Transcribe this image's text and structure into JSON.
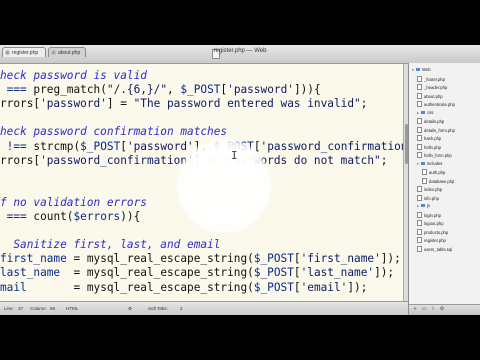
{
  "window": {
    "title": "register.php — Web",
    "tabs": [
      {
        "label": "register.php"
      },
      {
        "label": "about.php"
      }
    ]
  },
  "editor": {
    "lines": [
      [
        {
          "c": "cm",
          "t": "heck password is valid"
        }
      ],
      [
        {
          "c": "kw",
          "t": " === "
        },
        {
          "c": "fn",
          "t": "preg_match("
        },
        {
          "c": "st",
          "t": "\"/.{6,}/\""
        },
        {
          "c": "pu",
          "t": ", "
        },
        {
          "c": "kw",
          "t": "$_POST"
        },
        {
          "c": "pu",
          "t": "["
        },
        {
          "c": "st",
          "t": "'password'"
        },
        {
          "c": "pu",
          "t": "])){"
        }
      ],
      [
        {
          "c": "pu",
          "t": "rrors["
        },
        {
          "c": "st",
          "t": "'password'"
        },
        {
          "c": "pu",
          "t": "] = "
        },
        {
          "c": "st",
          "t": "\"The password entered was invalid\""
        },
        {
          "c": "pu",
          "t": ";"
        }
      ],
      [],
      [
        {
          "c": "cm",
          "t": "heck password confirmation matches"
        }
      ],
      [
        {
          "c": "kw",
          "t": " !== "
        },
        {
          "c": "fn",
          "t": "strcmp("
        },
        {
          "c": "kw",
          "t": "$_POST"
        },
        {
          "c": "pu",
          "t": "["
        },
        {
          "c": "st",
          "t": "'password'"
        },
        {
          "c": "pu",
          "t": "], "
        },
        {
          "c": "kw",
          "t": "$_POST"
        },
        {
          "c": "pu",
          "t": "["
        },
        {
          "c": "st",
          "t": "'password_confirmation"
        }
      ],
      [
        {
          "c": "pu",
          "t": "rrors["
        },
        {
          "c": "st",
          "t": "'password_confirmation'"
        },
        {
          "c": "pu",
          "t": "] = "
        },
        {
          "c": "st",
          "t": "\"Passwords do not match\""
        },
        {
          "c": "pu",
          "t": ";"
        }
      ],
      [],
      [],
      [
        {
          "c": "cm",
          "t": "f no validation errors"
        }
      ],
      [
        {
          "c": "kw",
          "t": " === "
        },
        {
          "c": "fn",
          "t": "count("
        },
        {
          "c": "kw",
          "t": "$errors"
        },
        {
          "c": "pu",
          "t": ")){"
        }
      ],
      [],
      [
        {
          "c": "cm",
          "t": "  Sanitize first, last, and email"
        }
      ],
      [
        {
          "c": "kw",
          "t": "first_name"
        },
        {
          "c": "pu",
          "t": " = "
        },
        {
          "c": "fn",
          "t": "mysql_real_escape_string("
        },
        {
          "c": "kw",
          "t": "$_POST"
        },
        {
          "c": "pu",
          "t": "["
        },
        {
          "c": "st",
          "t": "'first_name'"
        },
        {
          "c": "pu",
          "t": "]);"
        }
      ],
      [
        {
          "c": "kw",
          "t": "last_name"
        },
        {
          "c": "pu",
          "t": "  = "
        },
        {
          "c": "fn",
          "t": "mysql_real_escape_string("
        },
        {
          "c": "kw",
          "t": "$_POST"
        },
        {
          "c": "pu",
          "t": "["
        },
        {
          "c": "st",
          "t": "'last_name'"
        },
        {
          "c": "pu",
          "t": "]);"
        }
      ],
      [
        {
          "c": "kw",
          "t": "mail"
        },
        {
          "c": "pu",
          "t": "       = "
        },
        {
          "c": "fn",
          "t": "mysql_real_escape_string("
        },
        {
          "c": "kw",
          "t": "$_POST"
        },
        {
          "c": "pu",
          "t": "["
        },
        {
          "c": "st",
          "t": "'email'"
        },
        {
          "c": "pu",
          "t": "]);"
        }
      ]
    ]
  },
  "status": {
    "line": "Line:",
    "line_num": "37",
    "column": "Column:",
    "column_num": "69",
    "language": "HTML",
    "tab_mode": "Soft Tabs:",
    "tab_size": "2"
  },
  "project": {
    "items": [
      {
        "label": "Web",
        "kind": "folder",
        "level": 0,
        "open": true
      },
      {
        "label": "_footer.php",
        "kind": "file",
        "level": 1
      },
      {
        "label": "_header.php",
        "kind": "file",
        "level": 1
      },
      {
        "label": "about.php",
        "kind": "file",
        "level": 1
      },
      {
        "label": "authenticate.php",
        "kind": "file",
        "level": 1
      },
      {
        "label": "css",
        "kind": "folder",
        "level": 1,
        "open": false
      },
      {
        "label": "details.php",
        "kind": "file",
        "level": 1
      },
      {
        "label": "details_form.php",
        "kind": "file",
        "level": 1
      },
      {
        "label": "hash.php",
        "kind": "file",
        "level": 1
      },
      {
        "label": "hello.php",
        "kind": "file",
        "level": 1
      },
      {
        "label": "hello_form.php",
        "kind": "file",
        "level": 1
      },
      {
        "label": "includes",
        "kind": "folder",
        "level": 1,
        "open": true
      },
      {
        "label": "auth.php",
        "kind": "file",
        "level": 2
      },
      {
        "label": "database.php",
        "kind": "file",
        "level": 2
      },
      {
        "label": "index.php",
        "kind": "file",
        "level": 1
      },
      {
        "label": "info.php",
        "kind": "file",
        "level": 1
      },
      {
        "label": "js",
        "kind": "folder",
        "level": 1,
        "open": false
      },
      {
        "label": "login.php",
        "kind": "file",
        "level": 1
      },
      {
        "label": "logout.php",
        "kind": "file",
        "level": 1
      },
      {
        "label": "products.php",
        "kind": "file",
        "level": 1
      },
      {
        "label": "register.php",
        "kind": "file",
        "level": 1
      },
      {
        "label": "users_table.sql",
        "kind": "file",
        "level": 1
      }
    ]
  },
  "colors": {
    "editor_bg": "#fbf8ec",
    "comment": "#2d2dcc",
    "variable": "#0a2a84",
    "string": "#0d1a5c"
  }
}
